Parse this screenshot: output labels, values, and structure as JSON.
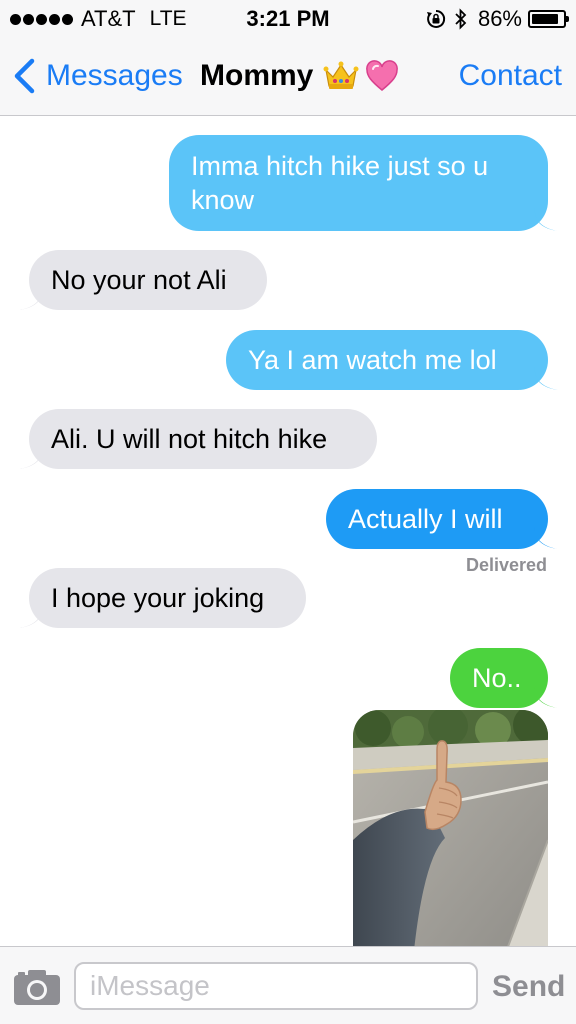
{
  "status_bar": {
    "carrier": "AT&T",
    "network": "LTE",
    "time": "3:21 PM",
    "battery_percent": "86%",
    "battery_level": 0.86,
    "signal_icon": "signal-dots-icon",
    "rotation_lock_icon": "rotation-lock-icon",
    "bluetooth_icon": "bluetooth-icon"
  },
  "nav": {
    "back_label": "Messages",
    "title": "Mommy",
    "title_emoji": [
      "crown-icon",
      "heart-icon"
    ],
    "contact_label": "Contact"
  },
  "messages": [
    {
      "direction": "sent",
      "text": "Imma hitch hike just so u know"
    },
    {
      "direction": "received",
      "text": "No your not Ali"
    },
    {
      "direction": "sent",
      "text": "Ya I am watch me lol"
    },
    {
      "direction": "received",
      "text": "Ali. U will not hitch hike"
    },
    {
      "direction": "sent",
      "text": "Actually I will"
    },
    {
      "direction": "received",
      "text": "I hope your joking"
    },
    {
      "direction": "sent",
      "text": "No.."
    },
    {
      "direction": "sent",
      "attachment": "photo-thumbs-up-roadside"
    }
  ],
  "delivery_status": "Delivered",
  "composer": {
    "placeholder": "iMessage",
    "value": "",
    "send_label": "Send"
  },
  "colors": {
    "ios_blue": "#1a7cf5",
    "imessage_bubble": "#1e9bf5",
    "sms_bubble": "#4cd33e",
    "received_bubble": "#e5e5ea",
    "muted_text": "#8e8e93"
  }
}
